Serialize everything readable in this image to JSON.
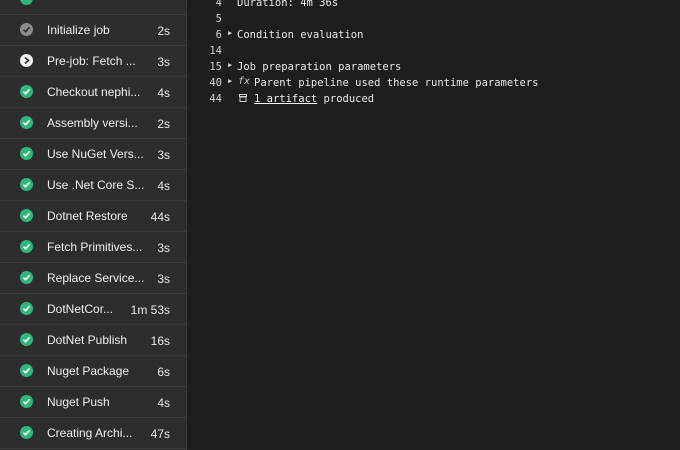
{
  "steps": [
    {
      "label": "Initialize job",
      "duration": "2s",
      "status": "done"
    },
    {
      "label": "Pre-job: Fetch ...",
      "duration": "3s",
      "status": "skipped"
    },
    {
      "label": "Checkout nephi...",
      "duration": "4s",
      "status": "success"
    },
    {
      "label": "Assembly versi...",
      "duration": "2s",
      "status": "success"
    },
    {
      "label": "Use NuGet Vers...",
      "duration": "3s",
      "status": "success"
    },
    {
      "label": "Use .Net Core S...",
      "duration": "4s",
      "status": "success"
    },
    {
      "label": "Dotnet Restore",
      "duration": "44s",
      "status": "success"
    },
    {
      "label": "Fetch Primitives...",
      "duration": "3s",
      "status": "success"
    },
    {
      "label": "Replace Service...",
      "duration": "3s",
      "status": "success"
    },
    {
      "label": "DotNetCor...",
      "duration": "1m 53s",
      "status": "success"
    },
    {
      "label": "DotNet Publish",
      "duration": "16s",
      "status": "success"
    },
    {
      "label": "Nuget Package",
      "duration": "6s",
      "status": "success"
    },
    {
      "label": "Nuget Push",
      "duration": "4s",
      "status": "success"
    },
    {
      "label": "Creating Archi...",
      "duration": "47s",
      "status": "success"
    }
  ],
  "log": {
    "lines": [
      {
        "num": "4",
        "text": "Duration: 4m 36s"
      },
      {
        "num": "5",
        "text": ""
      },
      {
        "num": "6",
        "text": "Condition evaluation",
        "expandable": true
      },
      {
        "num": "14",
        "text": ""
      },
      {
        "num": "15",
        "text": "Job preparation parameters",
        "expandable": true
      },
      {
        "num": "40",
        "text": "Parent pipeline used these runtime parameters",
        "expandable": true,
        "icon": "fx-icon"
      },
      {
        "num": "44",
        "link": "1 artifact",
        "text": "produced",
        "icon": "artifact-icon"
      }
    ]
  },
  "colors": {
    "success": "#2fb77b",
    "background": "#1e1e1e",
    "sidebar": "#2d2d2d"
  }
}
